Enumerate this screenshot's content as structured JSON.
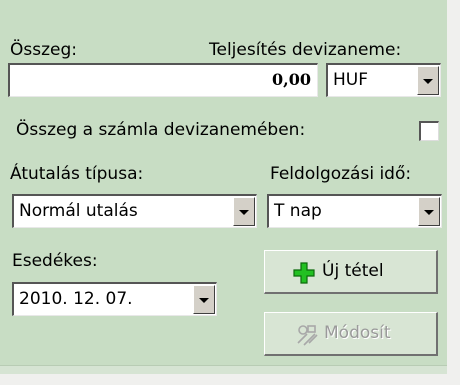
{
  "form": {
    "amount_label": "Összeg:",
    "currency_label": "Teljesítés devizaneme:",
    "amount_value": "0,00",
    "currency_value": "HUF",
    "invoice_currency_label": "Összeg a számla devizanemében:",
    "transfer_type_label": "Átutalás típusa:",
    "transfer_type_value": "Normál utalás",
    "processing_time_label": "Feldolgozási idő:",
    "processing_time_value": "T nap",
    "due_label": "Esedékes:",
    "due_value": "2010. 12. 07."
  },
  "buttons": {
    "new_item": "Új tétel",
    "modify": "Módosít"
  },
  "colors": {
    "panel_bg": "#c8ddc4",
    "plus_icon": "#22c022"
  }
}
